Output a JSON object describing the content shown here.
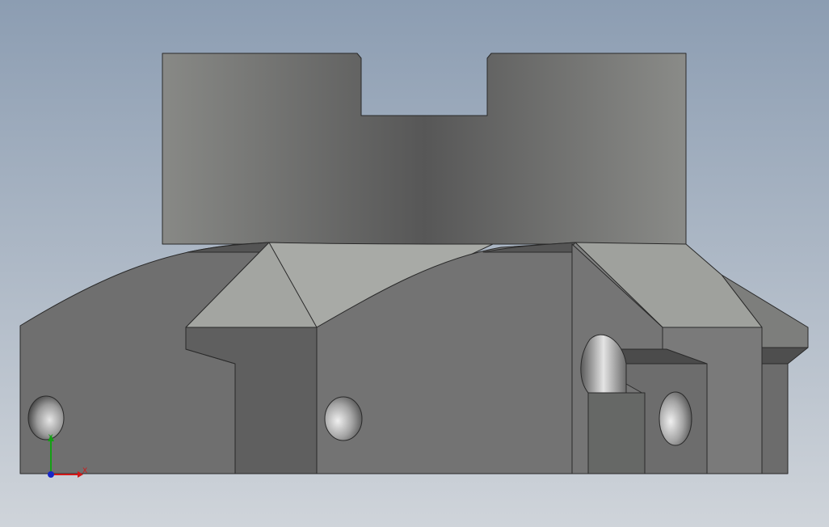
{
  "viewport": {
    "background_top": "#8c9db2",
    "background_bottom": "#cfd4da"
  },
  "triad": {
    "x_label": "X",
    "y_label": "Y",
    "x_color": "#d01818",
    "y_color": "#14a014",
    "z_color": "#1828c8"
  }
}
